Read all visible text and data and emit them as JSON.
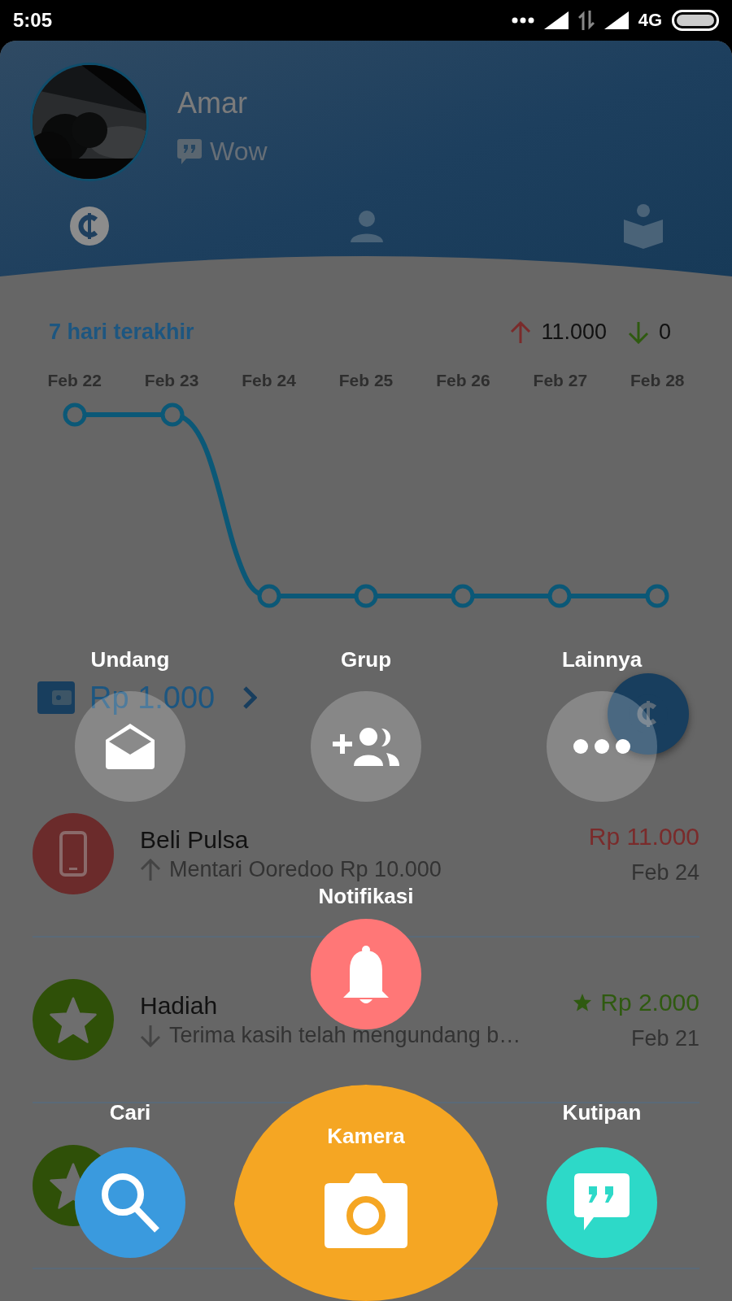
{
  "status_bar": {
    "time": "5:05",
    "network": "4G"
  },
  "profile": {
    "name": "Amar",
    "status": "Wow"
  },
  "tabs": [
    {
      "kind": "coin",
      "selected": true
    },
    {
      "kind": "person",
      "selected": false
    },
    {
      "kind": "book",
      "selected": false
    }
  ],
  "summary": {
    "period": "7 hari terakhir",
    "outgoing": "11.000",
    "incoming": "0"
  },
  "chart_dates": [
    "Feb 22",
    "Feb 23",
    "Feb 24",
    "Feb 25",
    "Feb 26",
    "Feb 27",
    "Feb 28"
  ],
  "balance": "Rp 1.000",
  "transactions": [
    {
      "kind": "phone",
      "title": "Beli Pulsa",
      "outgoing": true,
      "subtitle": "Mentari Ooredoo Rp 10.000",
      "amount": "Rp 11.000",
      "date": "Feb 24"
    },
    {
      "kind": "star",
      "title": "Hadiah",
      "outgoing": false,
      "subtitle": "Terima kasih telah mengundang b…",
      "amount": "Rp 2.000",
      "date": "Feb 21"
    },
    {
      "kind": "star"
    }
  ],
  "quick_menu": [
    {
      "kind": "envelope",
      "label": "Undang"
    },
    {
      "kind": "group",
      "label": "Grup"
    },
    {
      "kind": "more",
      "label": "Lainnya"
    },
    {
      "kind": "bell",
      "label": "Notifikasi"
    },
    {
      "kind": "search",
      "label": "Cari"
    },
    {
      "kind": "camera",
      "label": "Kamera"
    },
    {
      "kind": "quote",
      "label": "Kutipan"
    }
  ]
}
